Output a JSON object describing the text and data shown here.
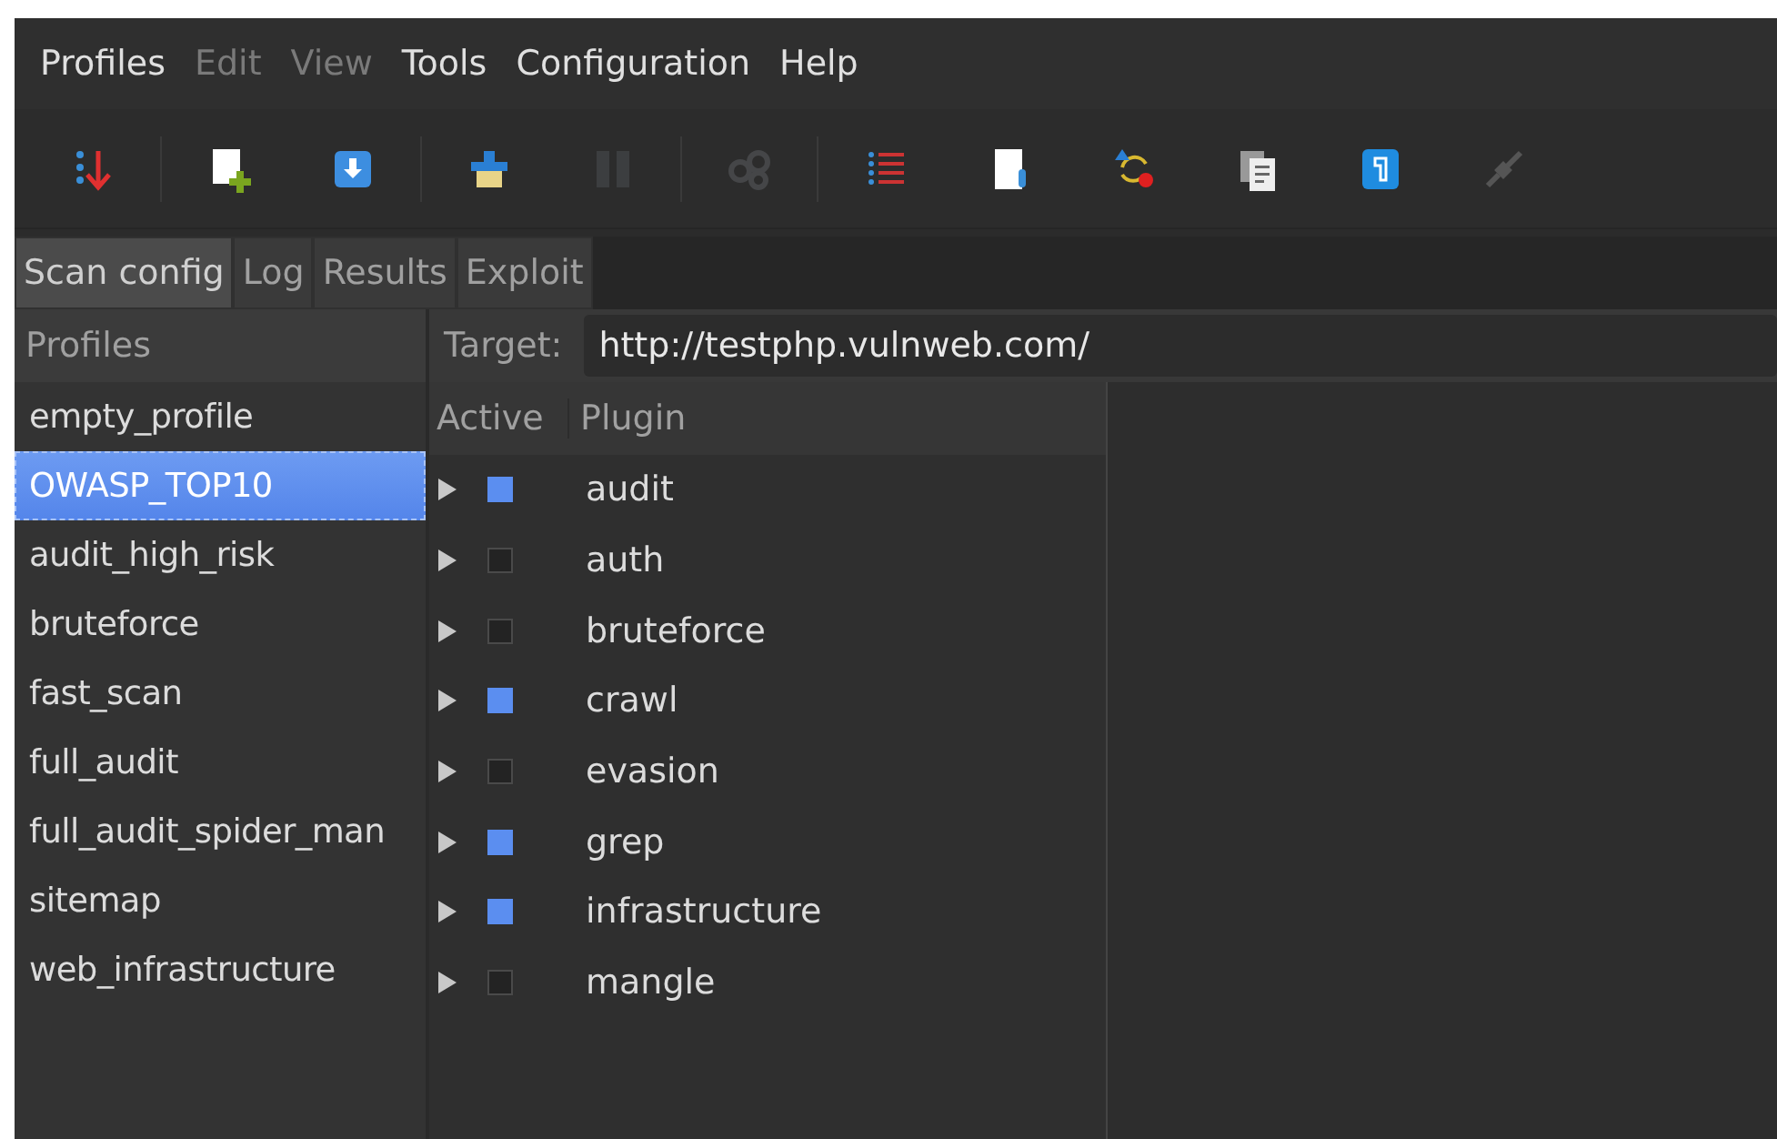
{
  "menu": [
    {
      "label": "Profiles",
      "disabled": false
    },
    {
      "label": "Edit",
      "disabled": true
    },
    {
      "label": "View",
      "disabled": true
    },
    {
      "label": "Tools",
      "disabled": false
    },
    {
      "label": "Configuration",
      "disabled": false
    },
    {
      "label": "Help",
      "disabled": false
    }
  ],
  "toolbar": [
    {
      "disabled": false
    },
    {
      "disabled": false
    },
    {
      "disabled": false
    },
    {
      "disabled": false
    },
    {
      "disabled": true
    },
    {
      "disabled": true
    },
    {
      "disabled": false
    },
    {
      "disabled": false
    },
    {
      "disabled": false
    },
    {
      "disabled": false
    },
    {
      "disabled": false
    },
    {
      "disabled": true
    }
  ],
  "tabs": [
    {
      "label": "Scan config",
      "selected": true
    },
    {
      "label": "Log",
      "selected": false
    },
    {
      "label": "Results",
      "selected": false
    },
    {
      "label": "Exploit",
      "selected": false
    }
  ],
  "profiles": {
    "header": "Profiles",
    "items": [
      {
        "label": "empty_profile",
        "selected": false
      },
      {
        "label": "OWASP_TOP10",
        "selected": true
      },
      {
        "label": "audit_high_risk",
        "selected": false
      },
      {
        "label": "bruteforce",
        "selected": false
      },
      {
        "label": "fast_scan",
        "selected": false
      },
      {
        "label": "full_audit",
        "selected": false
      },
      {
        "label": "full_audit_spider_man",
        "selected": false
      },
      {
        "label": "sitemap",
        "selected": false
      },
      {
        "label": "web_infrastructure",
        "selected": false
      }
    ]
  },
  "target": {
    "label": "Target:",
    "value": "http://testphp.vulnweb.com/"
  },
  "plugins": {
    "columns": [
      "Active",
      "Plugin"
    ],
    "rows": [
      {
        "name": "audit",
        "checked": true,
        "expanded": false
      },
      {
        "name": "auth",
        "checked": false,
        "expanded": false
      },
      {
        "name": "bruteforce",
        "checked": false,
        "expanded": false
      },
      {
        "name": "crawl",
        "checked": true,
        "expanded": false
      },
      {
        "name": "evasion",
        "checked": false,
        "expanded": false
      },
      {
        "name": "grep",
        "checked": true,
        "expanded": false
      },
      {
        "name": "infrastructure",
        "checked": true,
        "expanded": false
      },
      {
        "name": "mangle",
        "checked": false,
        "expanded": false
      }
    ]
  }
}
